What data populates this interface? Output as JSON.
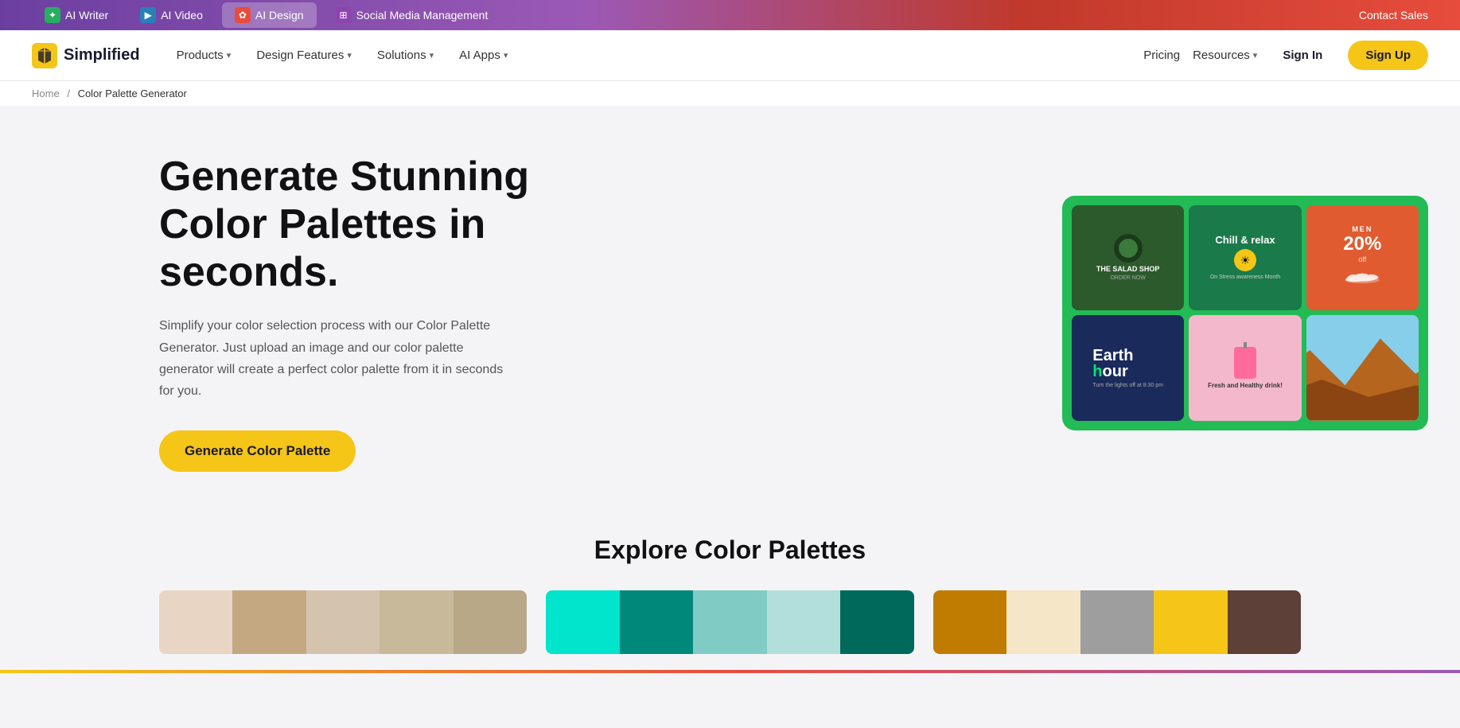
{
  "topBanner": {
    "tabs": [
      {
        "id": "aiwriter",
        "label": "AI Writer",
        "iconChar": "✦",
        "iconBg": "#27ae60",
        "active": false
      },
      {
        "id": "aivideo",
        "label": "AI Video",
        "iconChar": "▶",
        "iconBg": "#2980b9",
        "active": false
      },
      {
        "id": "aidesign",
        "label": "AI Design",
        "iconChar": "✿",
        "iconBg": "#e74c3c",
        "active": true
      },
      {
        "id": "social",
        "label": "Social Media Management",
        "iconChar": "⊞",
        "iconBg": "#8e44ad",
        "active": false
      }
    ],
    "contactSales": "Contact Sales"
  },
  "nav": {
    "logo": "Simplified",
    "items": [
      {
        "id": "products",
        "label": "Products",
        "hasDropdown": true
      },
      {
        "id": "design-features",
        "label": "Design Features",
        "hasDropdown": true
      },
      {
        "id": "solutions",
        "label": "Solutions",
        "hasDropdown": true
      },
      {
        "id": "ai-apps",
        "label": "AI Apps",
        "hasDropdown": true
      }
    ],
    "rightItems": {
      "pricing": "Pricing",
      "resources": "Resources",
      "signIn": "Sign In",
      "signUp": "Sign Up"
    }
  },
  "breadcrumb": {
    "home": "Home",
    "current": "Color Palette Generator"
  },
  "hero": {
    "title": "Generate Stunning Color Palettes in seconds.",
    "description": "Simplify your color selection process with our Color Palette Generator. Just upload an image and our color palette generator will create a perfect color palette from it in seconds for you.",
    "ctaButton": "Generate Color Palette"
  },
  "exploreSection": {
    "title": "Explore Color Palettes",
    "palettes": [
      {
        "id": "palette-1",
        "swatches": [
          "#e8d5c4",
          "#c4a882",
          "#d4c4ae",
          "#c8b99a",
          "#b8a888"
        ]
      },
      {
        "id": "palette-2",
        "swatches": [
          "#00e5cc",
          "#00897b",
          "#80cbc4",
          "#b2dfdb",
          "#00695c"
        ]
      },
      {
        "id": "palette-3",
        "swatches": [
          "#c07c00",
          "#f5e6c8",
          "#9e9e9e",
          "#f5c518",
          "#5d4037"
        ]
      }
    ]
  },
  "collage": {
    "cells": [
      {
        "id": "salad",
        "label": "THE SALAD SHOP",
        "sublabel": "ORDER NOW",
        "bg": "#2d5a2d"
      },
      {
        "id": "chill",
        "label": "Chill & relax",
        "sublabel": "On Stress awareness Month",
        "bg": "#1a7a4a"
      },
      {
        "id": "shoe",
        "label": "20%",
        "sublabel": "off",
        "bg": "#e05c30"
      },
      {
        "id": "earth",
        "label": "Earth hour",
        "sublabel": "Turn the lights off at 8:30 pm",
        "bg": "#1a2a5a"
      },
      {
        "id": "drink",
        "label": "Fresh and Healthy drink!",
        "sublabel": "",
        "bg": "#f4a7c0"
      },
      {
        "id": "desert",
        "label": "",
        "sublabel": "",
        "bg": "#c9a87c"
      }
    ]
  }
}
